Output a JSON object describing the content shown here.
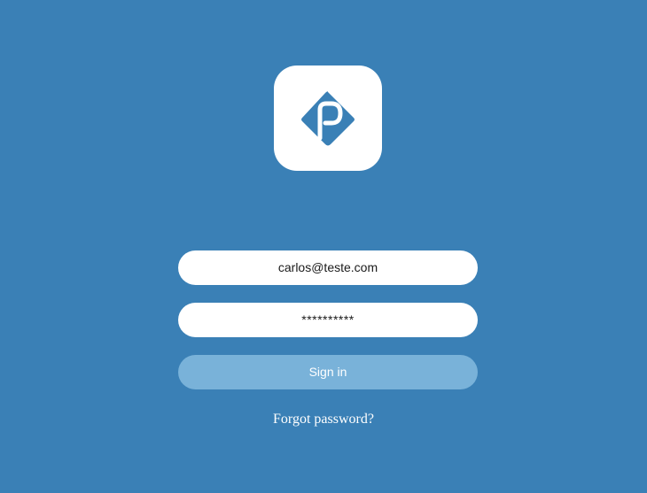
{
  "colors": {
    "background": "#3a80b6",
    "logo_mark": "#3a80b6",
    "field_background": "#ffffff",
    "button_background": "#79b2d9",
    "button_text": "#ffffff",
    "link_text": "#ffffff"
  },
  "logo": {
    "icon": "p-diamond-logo-icon"
  },
  "login_form": {
    "email_value": "carlos@teste.com",
    "password_value": "**********",
    "signin_label": "Sign in",
    "forgot_password_label": "Forgot password?"
  }
}
